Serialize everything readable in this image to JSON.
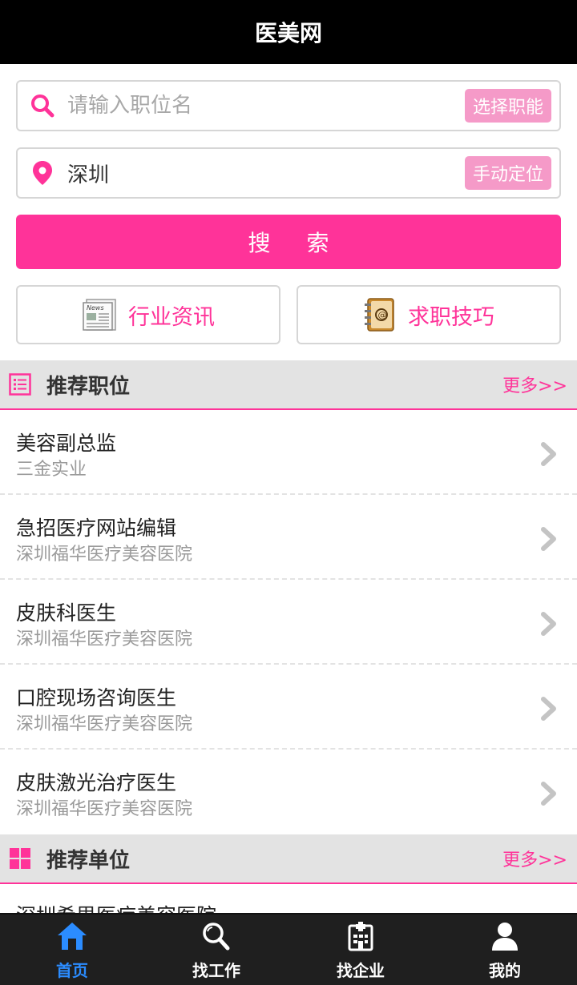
{
  "header": {
    "title": "医美网"
  },
  "search": {
    "job_placeholder": "请输入职位名",
    "job_select_label": "选择职能",
    "location_value": "深圳",
    "location_button_label": "手动定位",
    "search_button_label": "搜 索"
  },
  "quick_links": [
    {
      "label": "行业资讯",
      "icon": "news-icon"
    },
    {
      "label": "求职技巧",
      "icon": "address-book-icon"
    }
  ],
  "recommended_jobs": {
    "title": "推荐职位",
    "more_label": "更多>>",
    "items": [
      {
        "title": "美容副总监",
        "company": "三金实业"
      },
      {
        "title": "急招医疗网站编辑",
        "company": "深圳福华医疗美容医院"
      },
      {
        "title": "皮肤科医生",
        "company": "深圳福华医疗美容医院"
      },
      {
        "title": "口腔现场咨询医生",
        "company": "深圳福华医疗美容医院"
      },
      {
        "title": "皮肤激光治疗医生",
        "company": "深圳福华医疗美容医院"
      }
    ]
  },
  "recommended_units": {
    "title": "推荐单位",
    "more_label": "更多>>",
    "items": [
      {
        "name": "深圳希思医疗美容医院"
      }
    ]
  },
  "tabbar": {
    "items": [
      {
        "label": "首页",
        "icon": "home-icon",
        "active": true
      },
      {
        "label": "找工作",
        "icon": "search-icon",
        "active": false
      },
      {
        "label": "找企业",
        "icon": "hospital-icon",
        "active": false
      },
      {
        "label": "我的",
        "icon": "user-icon",
        "active": false
      }
    ]
  },
  "colors": {
    "accent": "#ff3399",
    "accent_light": "#f59ac8",
    "tab_active": "#2b8cff",
    "header_bg": "#000000"
  }
}
